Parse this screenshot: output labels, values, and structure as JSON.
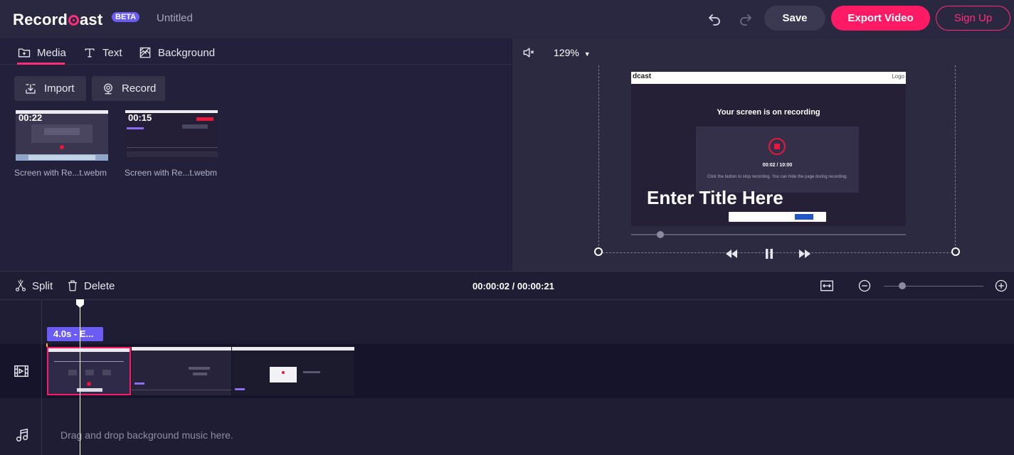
{
  "app": {
    "logo_left": "Record",
    "logo_right": "ast",
    "badge": "BETA",
    "document_title": "Untitled"
  },
  "header": {
    "save_label": "Save",
    "export_label": "Export Video",
    "signup_label": "Sign Up"
  },
  "tabs": [
    {
      "label": "Media",
      "icon": "media-folder-icon",
      "active": true
    },
    {
      "label": "Text",
      "icon": "text-icon",
      "active": false
    },
    {
      "label": "Background",
      "icon": "background-icon",
      "active": false
    }
  ],
  "media_actions": {
    "import_label": "Import",
    "record_label": "Record"
  },
  "media_items": [
    {
      "duration": "00:22",
      "name": "Screen with Re...t.webm"
    },
    {
      "duration": "00:15",
      "name": "Screen with Re...t.webm"
    }
  ],
  "preview": {
    "zoom": "129%",
    "overlay_title": "Enter Title Here",
    "frame": {
      "logo": "dcast",
      "nav_right": "Logo",
      "heading": "Your screen is on recording",
      "timer": "00:02 / 10:00",
      "hint": "Click the button to stop recording. You can hide the page during recording."
    }
  },
  "timeline": {
    "split_label": "Split",
    "delete_label": "Delete",
    "time": "00:00:02 / 00:00:21",
    "text_clip_label": "4.0s - E...",
    "music_hint": "Drag and drop background music here."
  },
  "colors": {
    "accent": "#ff1a66",
    "badge": "#6b5cf5",
    "background": "#1f1d33"
  }
}
